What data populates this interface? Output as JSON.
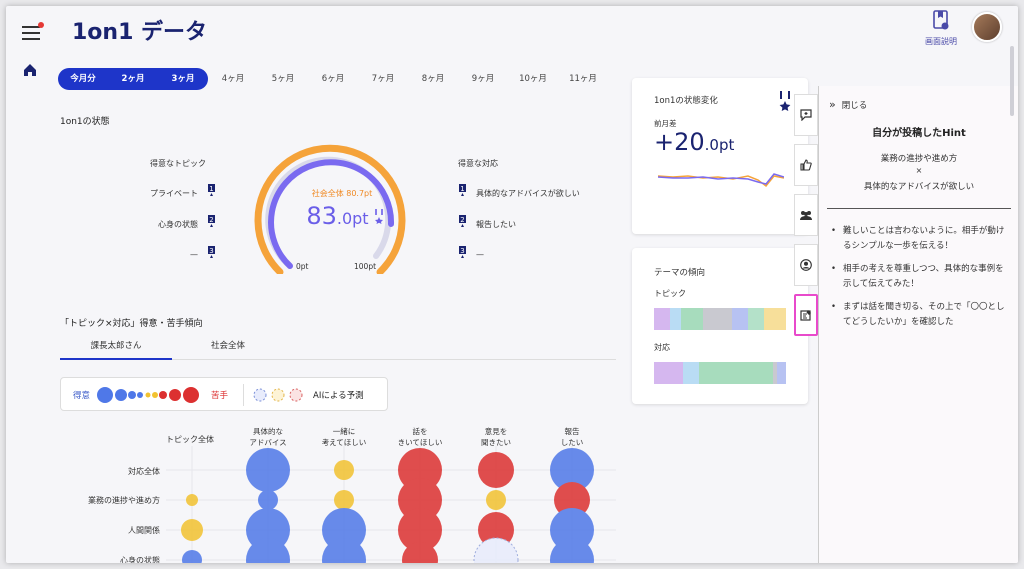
{
  "app": {
    "title": "1on1 データ",
    "help_label": "画面説明"
  },
  "months": [
    "今月分",
    "2ヶ月",
    "3ヶ月",
    "4ヶ月",
    "5ヶ月",
    "6ヶ月",
    "7ヶ月",
    "8ヶ月",
    "9ヶ月",
    "10ヶ月",
    "11ヶ月"
  ],
  "status": {
    "section_title": "1on1の状態",
    "strong_topics_title": "得意なトピック",
    "strong_topics": [
      "プライベート",
      "心身の状態",
      "—"
    ],
    "strong_responses_title": "得意な対応",
    "strong_responses": [
      "具体的なアドバイスが欲しい",
      "報告したい",
      "—"
    ],
    "ranks": [
      "1",
      "2",
      "3"
    ],
    "society_label": "社会全体 80.7pt",
    "score_int": "83",
    "score_dec": ".0pt",
    "scale_min": "0pt",
    "scale_max": "100pt"
  },
  "tendency": {
    "title": "「トピック×対応」得意・苦手傾向",
    "tabs": [
      "課長太郎さん",
      "社会全体"
    ],
    "legend_good": "得意",
    "legend_bad": "苦手",
    "legend_ai": "AIによる予測",
    "topic_all": "トピック全体",
    "columns": [
      "具体的な\nアドバイス",
      "一緒に\n考えてほしい",
      "話を\nきいてほしい",
      "意見を\n聞きたい",
      "報告\nしたい"
    ],
    "rows": [
      "対応全体",
      "業務の進捗や進め方",
      "人間関係",
      "心身の状態"
    ]
  },
  "change_card": {
    "title": "1on1の状態変化",
    "diff_label": "前月差",
    "diff_int": "+20",
    "diff_dec": ".0pt"
  },
  "theme_card": {
    "title": "テーマの傾向",
    "topic_label": "トピック",
    "response_label": "対応"
  },
  "hint": {
    "close_label": "閉じる",
    "title": "自分が投稿したHint",
    "topic": "業務の進捗や進め方",
    "cross": "×",
    "response": "具体的なアドバイスが欲しい",
    "items": [
      "難しいことは言わないように。相手が動けるシンプルな一歩を伝える！",
      "相手の考えを尊重しつつ、具体的な事例を示して伝えてみた！",
      "まずは話を聞き切る、その上で「〇〇としてどうしたいか」を確認した"
    ]
  },
  "colors": {
    "brand": "#1a2370",
    "active_month": "#1e35c9",
    "good": "#4f78e8",
    "neutral": "#f2c230",
    "bad": "#dc3030",
    "gauge_outer": "#f5a33a",
    "gauge_inner": "#7a6af0",
    "highlight": "#e84acb"
  },
  "icons": [
    "hamburger-icon",
    "home-icon",
    "book-icon",
    "medal-icon",
    "chat-add-icon",
    "thumbs-up-icon",
    "group-icon",
    "user-icon",
    "note-edit-icon",
    "double-chevron-right-icon"
  ]
}
